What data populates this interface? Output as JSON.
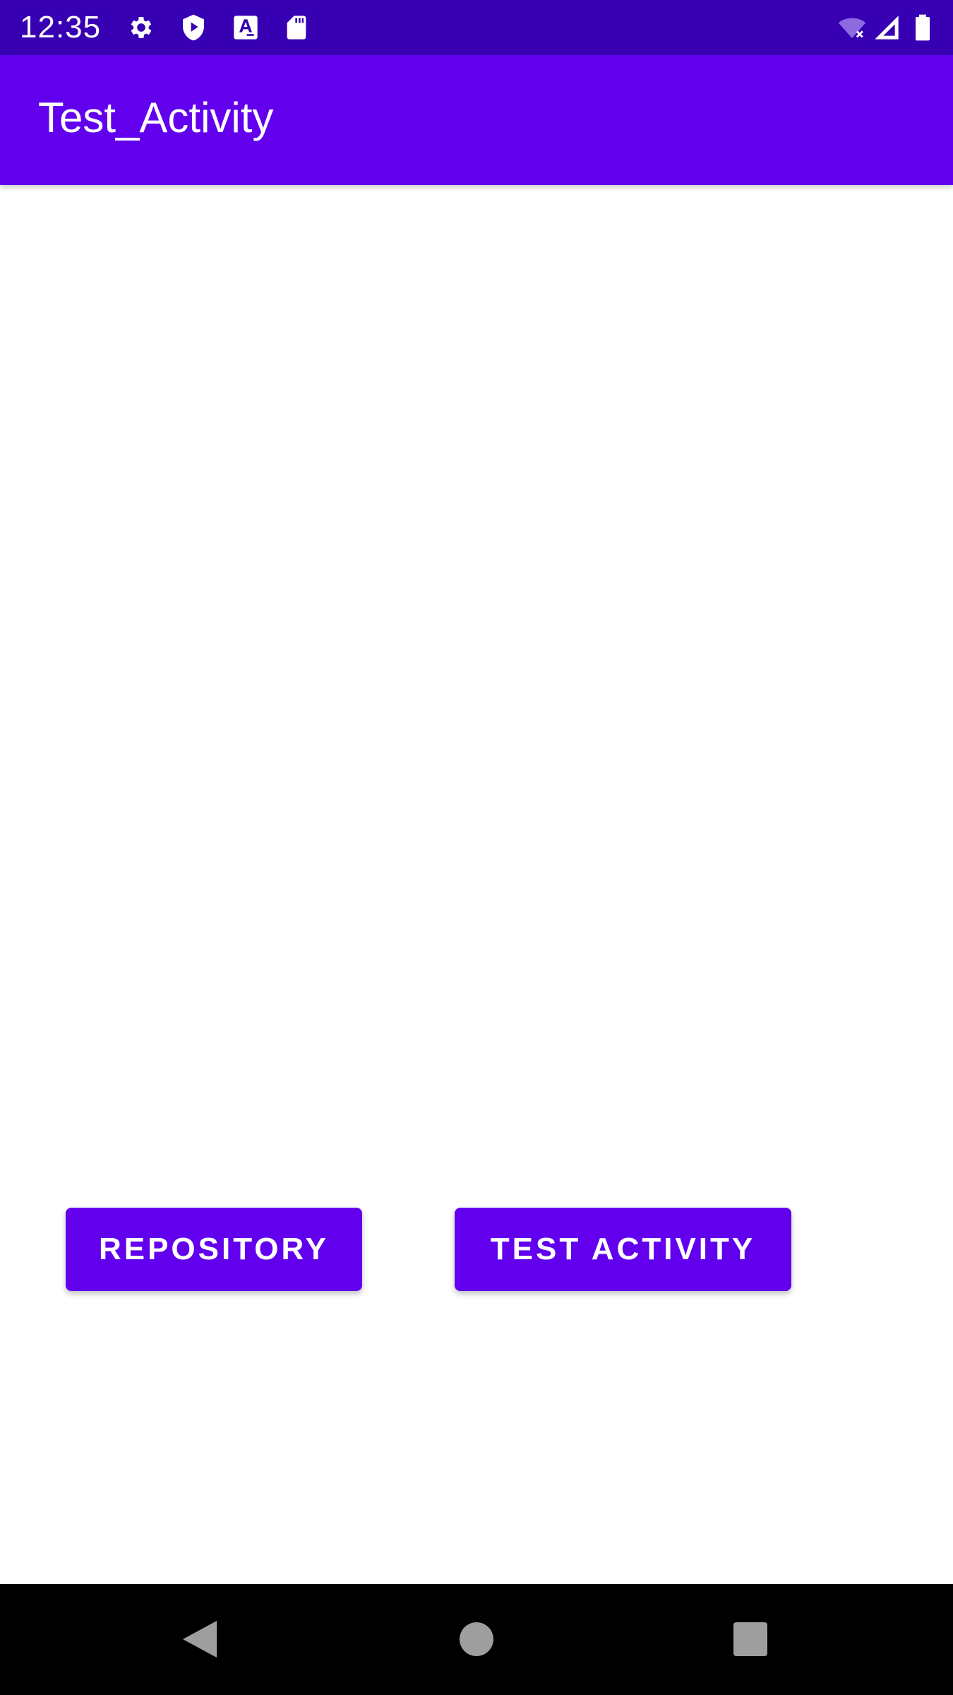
{
  "status_bar": {
    "time": "12:35",
    "icons_left": [
      "settings-icon",
      "play-protect-icon",
      "text-a-icon",
      "sd-card-icon"
    ],
    "icons_right": [
      "wifi-off-icon",
      "cell-signal-icon",
      "battery-icon"
    ]
  },
  "app_bar": {
    "title": "Test_Activity"
  },
  "buttons": {
    "repository_label": "REPOSITORY",
    "test_activity_label": "TEST ACTIVITY"
  },
  "nav_bar": {
    "icons": [
      "back-icon",
      "home-icon",
      "recents-icon"
    ]
  },
  "colors": {
    "status_bar": "#3700B3",
    "primary": "#6200EE",
    "background": "#FFFFFF",
    "nav_bar": "#000000"
  }
}
